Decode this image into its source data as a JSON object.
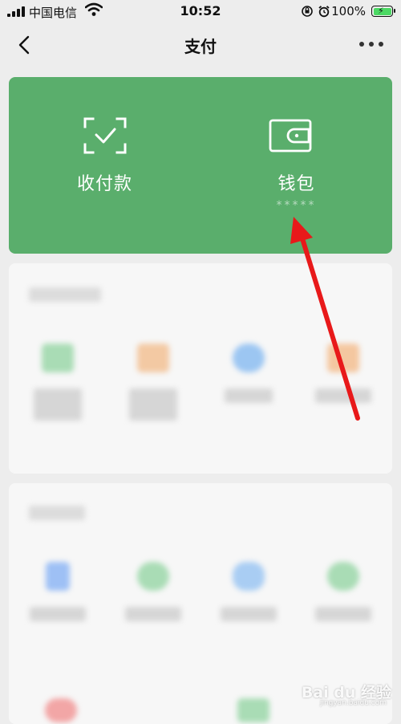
{
  "status_bar": {
    "carrier": "中国电信",
    "time": "10:52",
    "battery_percent": "100%",
    "battery_level": 1.0
  },
  "nav": {
    "title": "支付",
    "back_icon": "chevron-left-icon",
    "more_icon": "more-dots-icon"
  },
  "card": {
    "background": "#5aae6c",
    "items": [
      {
        "label": "收付款",
        "icon": "scan-check-icon"
      },
      {
        "label": "钱包",
        "sub": "*****",
        "icon": "wallet-icon"
      }
    ]
  },
  "annotation": {
    "arrow_color": "#e8191a"
  },
  "watermark": {
    "logo": "Bai du 经验",
    "domain": "jingyan.baidu.com"
  }
}
